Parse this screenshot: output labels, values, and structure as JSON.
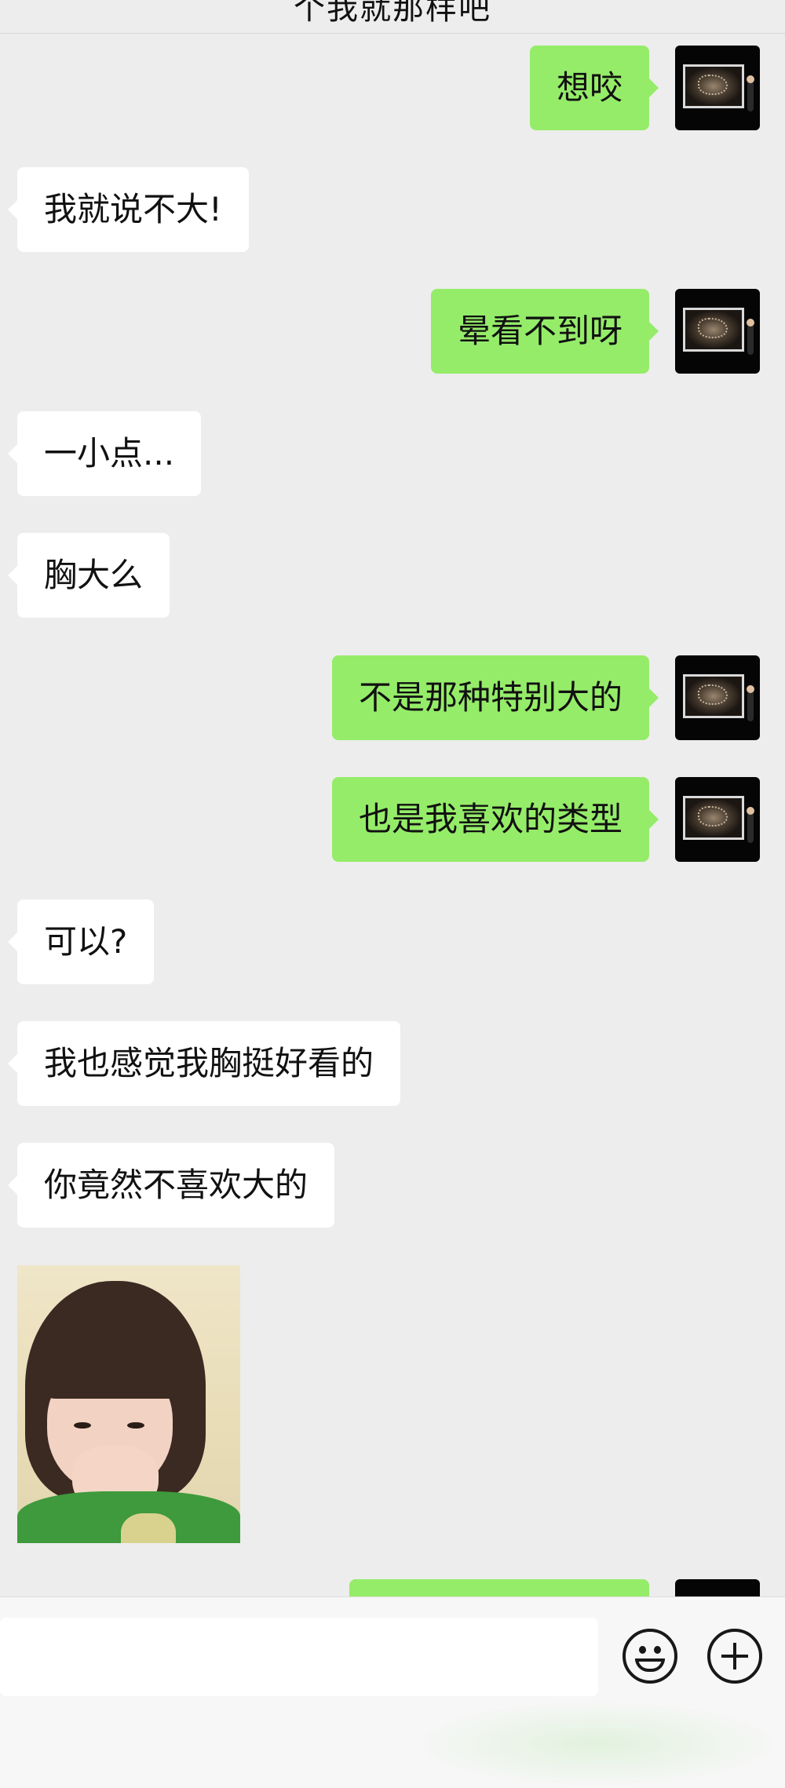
{
  "header": {
    "title": "个我就那样吧"
  },
  "messages": [
    {
      "side": "out",
      "text": "想咬"
    },
    {
      "side": "in",
      "text": "我就说不大!"
    },
    {
      "side": "out",
      "text": "晕看不到呀"
    },
    {
      "side": "in",
      "text": "一小点..."
    },
    {
      "side": "in",
      "text": "胸大么"
    },
    {
      "side": "out",
      "text": "不是那种特别大的"
    },
    {
      "side": "out",
      "text": "也是我喜欢的类型"
    },
    {
      "side": "in",
      "text": "可以?"
    },
    {
      "side": "in",
      "text": "我也感觉我胸挺好看的"
    },
    {
      "side": "in",
      "text": "你竟然不喜欢大的"
    },
    {
      "side": "in",
      "type": "sticker",
      "icon": "girl-covering-nose-sticker"
    },
    {
      "side": "out",
      "text": ""
    }
  ],
  "input_bar": {
    "placeholder": "",
    "emoji_icon": "smiley-icon",
    "plus_icon": "plus-circle-icon"
  },
  "colors": {
    "background": "#ededed",
    "outgoing_bubble": "#95ec69",
    "incoming_bubble": "#ffffff"
  }
}
